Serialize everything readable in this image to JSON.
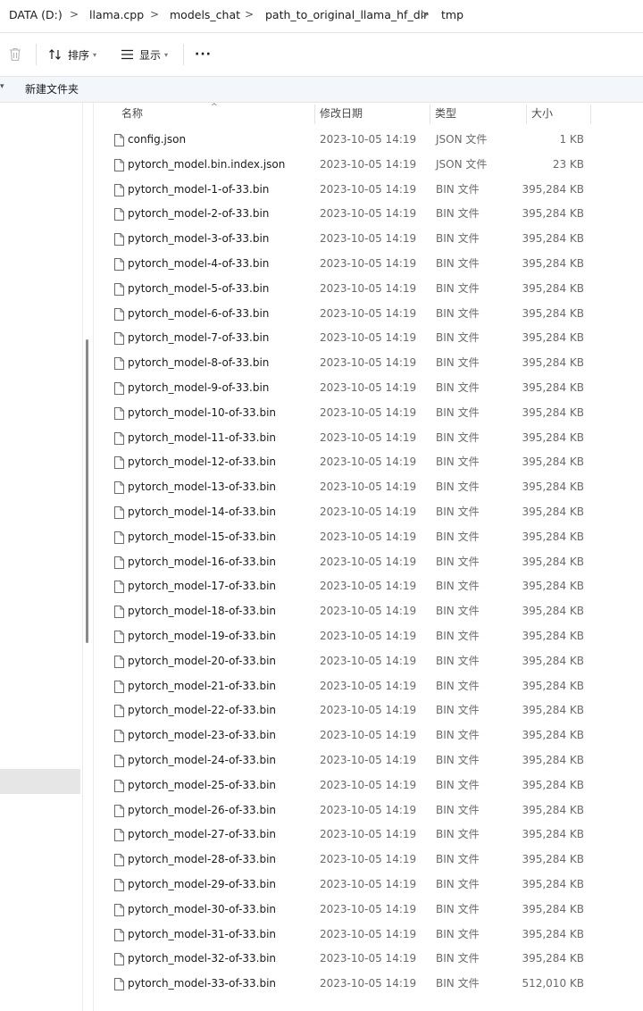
{
  "breadcrumb": {
    "segments": [
      "DATA (D:)",
      "llama.cpp",
      "models_chat",
      "path_to_original_llama_hf_dir",
      "tmp"
    ],
    "separator": ">"
  },
  "toolbar": {
    "delete_icon": "trash-icon",
    "sort_label": "排序",
    "view_label": "显示",
    "more_label": "···"
  },
  "cmdbar": {
    "new_folder_label": "新建文件夹"
  },
  "columns": {
    "name": "名称",
    "date": "修改日期",
    "type": "类型",
    "size": "大小"
  },
  "files": [
    {
      "name": "config.json",
      "date": "2023-10-05 14:19",
      "type": "JSON 文件",
      "size": "1 KB"
    },
    {
      "name": "pytorch_model.bin.index.json",
      "date": "2023-10-05 14:19",
      "type": "JSON 文件",
      "size": "23 KB"
    },
    {
      "name": "pytorch_model-1-of-33.bin",
      "date": "2023-10-05 14:19",
      "type": "BIN 文件",
      "size": "395,284 KB"
    },
    {
      "name": "pytorch_model-2-of-33.bin",
      "date": "2023-10-05 14:19",
      "type": "BIN 文件",
      "size": "395,284 KB"
    },
    {
      "name": "pytorch_model-3-of-33.bin",
      "date": "2023-10-05 14:19",
      "type": "BIN 文件",
      "size": "395,284 KB"
    },
    {
      "name": "pytorch_model-4-of-33.bin",
      "date": "2023-10-05 14:19",
      "type": "BIN 文件",
      "size": "395,284 KB"
    },
    {
      "name": "pytorch_model-5-of-33.bin",
      "date": "2023-10-05 14:19",
      "type": "BIN 文件",
      "size": "395,284 KB"
    },
    {
      "name": "pytorch_model-6-of-33.bin",
      "date": "2023-10-05 14:19",
      "type": "BIN 文件",
      "size": "395,284 KB"
    },
    {
      "name": "pytorch_model-7-of-33.bin",
      "date": "2023-10-05 14:19",
      "type": "BIN 文件",
      "size": "395,284 KB"
    },
    {
      "name": "pytorch_model-8-of-33.bin",
      "date": "2023-10-05 14:19",
      "type": "BIN 文件",
      "size": "395,284 KB"
    },
    {
      "name": "pytorch_model-9-of-33.bin",
      "date": "2023-10-05 14:19",
      "type": "BIN 文件",
      "size": "395,284 KB"
    },
    {
      "name": "pytorch_model-10-of-33.bin",
      "date": "2023-10-05 14:19",
      "type": "BIN 文件",
      "size": "395,284 KB"
    },
    {
      "name": "pytorch_model-11-of-33.bin",
      "date": "2023-10-05 14:19",
      "type": "BIN 文件",
      "size": "395,284 KB"
    },
    {
      "name": "pytorch_model-12-of-33.bin",
      "date": "2023-10-05 14:19",
      "type": "BIN 文件",
      "size": "395,284 KB"
    },
    {
      "name": "pytorch_model-13-of-33.bin",
      "date": "2023-10-05 14:19",
      "type": "BIN 文件",
      "size": "395,284 KB"
    },
    {
      "name": "pytorch_model-14-of-33.bin",
      "date": "2023-10-05 14:19",
      "type": "BIN 文件",
      "size": "395,284 KB"
    },
    {
      "name": "pytorch_model-15-of-33.bin",
      "date": "2023-10-05 14:19",
      "type": "BIN 文件",
      "size": "395,284 KB"
    },
    {
      "name": "pytorch_model-16-of-33.bin",
      "date": "2023-10-05 14:19",
      "type": "BIN 文件",
      "size": "395,284 KB"
    },
    {
      "name": "pytorch_model-17-of-33.bin",
      "date": "2023-10-05 14:19",
      "type": "BIN 文件",
      "size": "395,284 KB"
    },
    {
      "name": "pytorch_model-18-of-33.bin",
      "date": "2023-10-05 14:19",
      "type": "BIN 文件",
      "size": "395,284 KB"
    },
    {
      "name": "pytorch_model-19-of-33.bin",
      "date": "2023-10-05 14:19",
      "type": "BIN 文件",
      "size": "395,284 KB"
    },
    {
      "name": "pytorch_model-20-of-33.bin",
      "date": "2023-10-05 14:19",
      "type": "BIN 文件",
      "size": "395,284 KB"
    },
    {
      "name": "pytorch_model-21-of-33.bin",
      "date": "2023-10-05 14:19",
      "type": "BIN 文件",
      "size": "395,284 KB"
    },
    {
      "name": "pytorch_model-22-of-33.bin",
      "date": "2023-10-05 14:19",
      "type": "BIN 文件",
      "size": "395,284 KB"
    },
    {
      "name": "pytorch_model-23-of-33.bin",
      "date": "2023-10-05 14:19",
      "type": "BIN 文件",
      "size": "395,284 KB"
    },
    {
      "name": "pytorch_model-24-of-33.bin",
      "date": "2023-10-05 14:19",
      "type": "BIN 文件",
      "size": "395,284 KB"
    },
    {
      "name": "pytorch_model-25-of-33.bin",
      "date": "2023-10-05 14:19",
      "type": "BIN 文件",
      "size": "395,284 KB"
    },
    {
      "name": "pytorch_model-26-of-33.bin",
      "date": "2023-10-05 14:19",
      "type": "BIN 文件",
      "size": "395,284 KB"
    },
    {
      "name": "pytorch_model-27-of-33.bin",
      "date": "2023-10-05 14:19",
      "type": "BIN 文件",
      "size": "395,284 KB"
    },
    {
      "name": "pytorch_model-28-of-33.bin",
      "date": "2023-10-05 14:19",
      "type": "BIN 文件",
      "size": "395,284 KB"
    },
    {
      "name": "pytorch_model-29-of-33.bin",
      "date": "2023-10-05 14:19",
      "type": "BIN 文件",
      "size": "395,284 KB"
    },
    {
      "name": "pytorch_model-30-of-33.bin",
      "date": "2023-10-05 14:19",
      "type": "BIN 文件",
      "size": "395,284 KB"
    },
    {
      "name": "pytorch_model-31-of-33.bin",
      "date": "2023-10-05 14:19",
      "type": "BIN 文件",
      "size": "395,284 KB"
    },
    {
      "name": "pytorch_model-32-of-33.bin",
      "date": "2023-10-05 14:19",
      "type": "BIN 文件",
      "size": "395,284 KB"
    },
    {
      "name": "pytorch_model-33-of-33.bin",
      "date": "2023-10-05 14:19",
      "type": "BIN 文件",
      "size": "512,010 KB"
    }
  ]
}
